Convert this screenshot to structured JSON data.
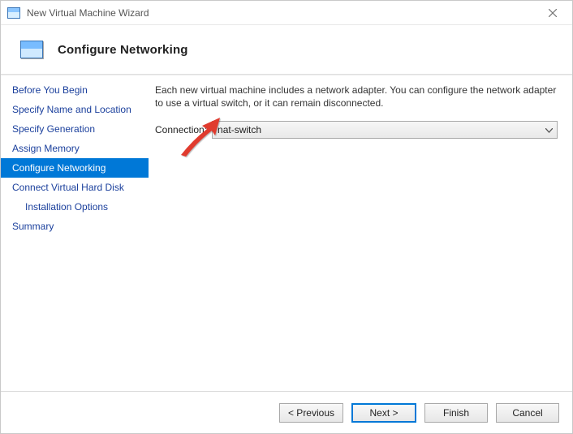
{
  "window": {
    "title": "New Virtual Machine Wizard"
  },
  "header": {
    "title": "Configure Networking"
  },
  "sidebar": {
    "items": [
      {
        "label": "Before You Begin"
      },
      {
        "label": "Specify Name and Location"
      },
      {
        "label": "Specify Generation"
      },
      {
        "label": "Assign Memory"
      },
      {
        "label": "Configure Networking"
      },
      {
        "label": "Connect Virtual Hard Disk"
      },
      {
        "label": "Installation Options"
      },
      {
        "label": "Summary"
      }
    ]
  },
  "content": {
    "description": "Each new virtual machine includes a network adapter. You can configure the network adapter to use a virtual switch, or it can remain disconnected.",
    "connection_label": "Connection:",
    "connection_value": "nat-switch"
  },
  "footer": {
    "previous": "< Previous",
    "next": "Next >",
    "finish": "Finish",
    "cancel": "Cancel"
  }
}
